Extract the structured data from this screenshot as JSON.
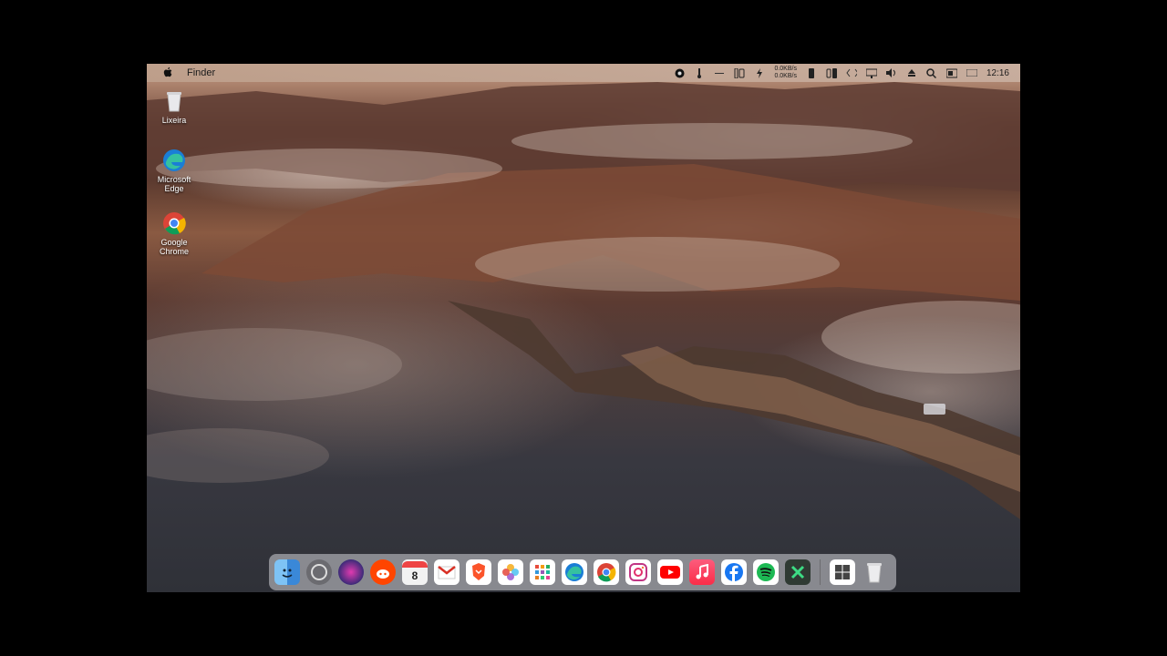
{
  "menubar": {
    "app_name": "Finder",
    "net_up": "0.0KB/s",
    "net_down": "0.0KB/s",
    "clock": "12:16"
  },
  "desktop_icons": [
    {
      "label": "Lixeira",
      "icon": "trash-icon"
    },
    {
      "label": "Microsoft Edge",
      "icon": "edge-icon"
    },
    {
      "label": "Google Chrome",
      "icon": "chrome-icon"
    }
  ],
  "dock": {
    "apps": [
      {
        "name": "finder-icon",
        "color": "#4a90d9"
      },
      {
        "name": "launchpad-icon",
        "color": "#6b6b70"
      },
      {
        "name": "siri-icon",
        "color": "#3c2b78"
      },
      {
        "name": "reddit-icon",
        "color": "#ff4500"
      },
      {
        "name": "calendar-icon",
        "color": "#f2f2f2"
      },
      {
        "name": "gmail-icon",
        "color": "#ffffff"
      },
      {
        "name": "brave-icon",
        "color": "#ffffff"
      },
      {
        "name": "photos-icon",
        "color": "#ffffff"
      },
      {
        "name": "apps-grid-icon",
        "color": "#ffffff"
      },
      {
        "name": "edge-icon",
        "color": "#1e7fd4"
      },
      {
        "name": "chrome-icon",
        "color": "#ffffff"
      },
      {
        "name": "instagram-icon",
        "color": "#ffffff"
      },
      {
        "name": "youtube-icon",
        "color": "#ff0000"
      },
      {
        "name": "music-icon",
        "color": "#fa2d48"
      },
      {
        "name": "facebook-icon",
        "color": "#1877f2"
      },
      {
        "name": "spotify-icon",
        "color": "#1db954"
      },
      {
        "name": "xcode-icon",
        "color": "#2c6e3b"
      }
    ],
    "extras": [
      {
        "name": "windows-icon",
        "color": "#ffffff"
      },
      {
        "name": "trash-icon",
        "color": "#e8e8ea"
      }
    ]
  }
}
